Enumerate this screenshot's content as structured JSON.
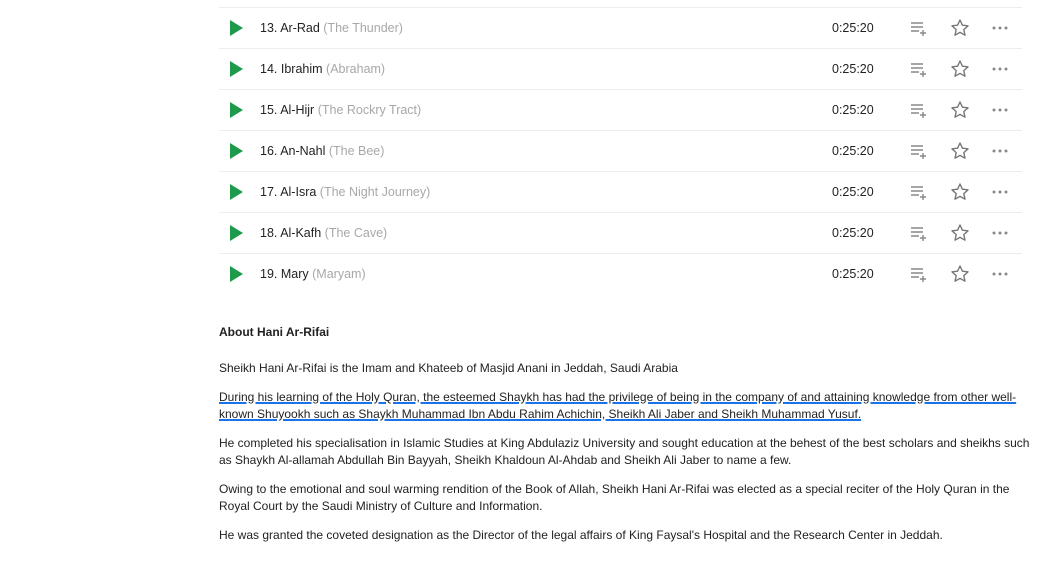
{
  "tracks": [
    {
      "number": "13.",
      "name": "Ar-Rad",
      "translation": "(The Thunder)",
      "duration": "0:25:20"
    },
    {
      "number": "14.",
      "name": "Ibrahim",
      "translation": "(Abraham)",
      "duration": "0:25:20"
    },
    {
      "number": "15.",
      "name": " Al-Hijr",
      "translation": "(The Rockry Tract)",
      "duration": "0:25:20"
    },
    {
      "number": "16.",
      "name": "An-Nahl",
      "translation": "(The Bee)",
      "duration": "0:25:20"
    },
    {
      "number": "17.",
      "name": "Al-Isra",
      "translation": "(The Night Journey)",
      "duration": "0:25:20"
    },
    {
      "number": "18.",
      "name": "Al-Kafh",
      "translation": "(The Cave)",
      "duration": "0:25:20"
    },
    {
      "number": "19.",
      "name": "Mary",
      "translation": "(Maryam)",
      "duration": "0:25:20"
    }
  ],
  "icons": {
    "play": "play-icon",
    "queue": "add-to-queue-icon",
    "favorite": "star-icon",
    "more": "more-options-icon"
  },
  "colors": {
    "play": "#1e9a4c",
    "secondary_text": "#a8a8a8",
    "highlight_underline": "#1a73e8"
  },
  "about": {
    "heading": "About Hani Ar-Rifai",
    "paragraphs": [
      "Sheikh Hani Ar-Rifai is the Imam and Khateeb of Masjid Anani in Jeddah, Saudi Arabia",
      "During his learning of the Holy Quran, the esteemed Shaykh has had the privilege of being in the company of and attaining knowledge from other well-known Shuyookh such as Shaykh Muhammad Ibn Abdu Rahim Achichin, Sheikh Ali Jaber and Sheikh Muhammad Yusuf.",
      "He completed his specialisation in Islamic Studies at King Abdulaziz University and sought education at the behest of the best scholars and sheikhs such as Shaykh Al-allamah Abdullah Bin Bayyah, Sheikh Khaldoun Al-Ahdab and Sheikh Ali Jaber to name a few.",
      "Owing to the emotional and soul warming rendition of the Book of Allah, Sheikh Hani Ar-Rifai was elected as a  special reciter of the Holy Quran in the Royal Court by the Saudi Ministry of Culture and Information.",
      "He was granted the coveted designation as the Director of the legal affairs of King Faysal's Hospital and the Research Center in Jeddah."
    ]
  }
}
